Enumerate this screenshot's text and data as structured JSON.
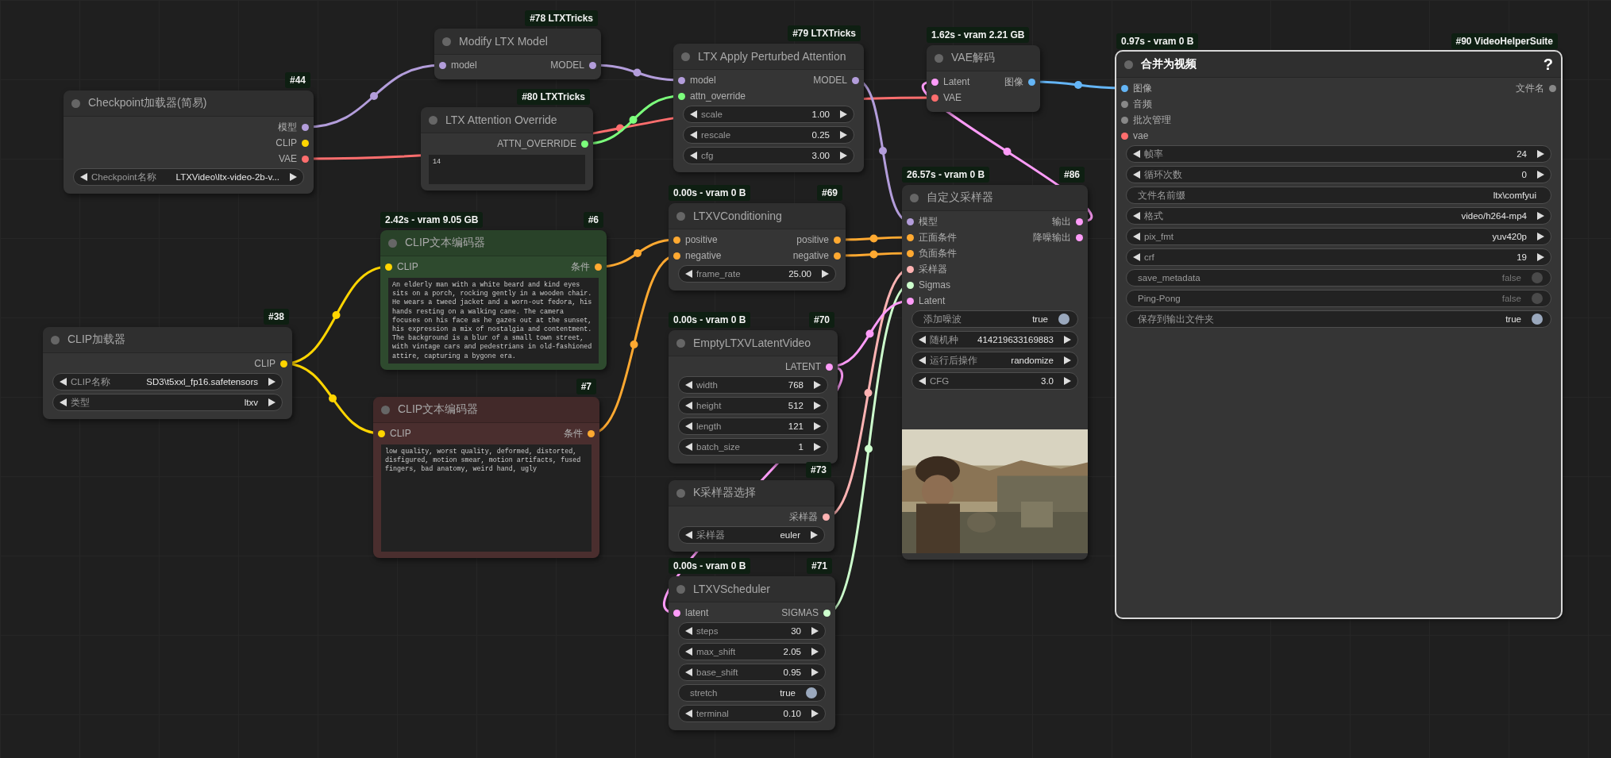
{
  "nodes": [
    {
      "badge": "#44",
      "title": "Checkpoint加载器(简易)",
      "selected": false,
      "outputs": [
        {
          "label": "模型",
          "color": "#b39ddb"
        },
        {
          "label": "CLIP",
          "color": "#ffd500"
        },
        {
          "label": "VAE",
          "color": "#ff6e6e"
        }
      ],
      "widgets": [
        {
          "kind": "stepper",
          "label": "Checkpoint名称",
          "value": "LTXVideo\\ltx-video-2b-v..."
        }
      ]
    },
    {
      "badge": "#78 LTXTricks",
      "title": "Modify LTX Model",
      "selected": false,
      "inputs": [
        {
          "label": "model",
          "color": "#b39ddb"
        }
      ],
      "outputs": [
        {
          "label": "MODEL",
          "color": "#b39ddb"
        }
      ]
    },
    {
      "badge": "#80 LTXTricks",
      "title": "LTX Attention Override",
      "selected": false,
      "outputs": [
        {
          "label": "ATTN_OVERRIDE",
          "color": "#7cff7c"
        }
      ],
      "widgets": [
        {
          "kind": "textarea",
          "value": "14"
        }
      ]
    },
    {
      "badge": "#79 LTXTricks",
      "title": "LTX Apply Perturbed Attention",
      "selected": false,
      "inputs": [
        {
          "label": "model",
          "color": "#b39ddb"
        },
        {
          "label": "attn_override",
          "color": "#7cff7c"
        }
      ],
      "outputs": [
        {
          "label": "MODEL",
          "color": "#b39ddb"
        }
      ],
      "widgets": [
        {
          "kind": "stepper",
          "label": "scale",
          "value": "1.00"
        },
        {
          "kind": "stepper",
          "label": "rescale",
          "value": "0.25"
        },
        {
          "kind": "stepper",
          "label": "cfg",
          "value": "3.00"
        }
      ]
    },
    {
      "timing": "1.62s - vram 2.21 GB",
      "title": "VAE解码",
      "selected": false,
      "inputs": [
        {
          "label": "Latent",
          "color": "#ff9cf9"
        },
        {
          "label": "VAE",
          "color": "#ff6e6e"
        }
      ],
      "outputs": [
        {
          "label": "图像",
          "color": "#64b5f6"
        }
      ]
    },
    {
      "timing": "0.97s - vram 0 B",
      "badge": "#90 VideoHelperSuite",
      "title": "合并为视频",
      "help": "?",
      "selected": true,
      "inputs": [
        {
          "label": "图像",
          "color": "#64b5f6"
        },
        {
          "label": "音频",
          "color": "#888888"
        },
        {
          "label": "批次管理",
          "color": "#888888"
        },
        {
          "label": "vae",
          "color": "#ff6e6e"
        }
      ],
      "outputs": [
        {
          "label": "文件名",
          "color": "#888888"
        }
      ],
      "widgets": [
        {
          "kind": "stepper",
          "label": "帧率",
          "value": "24"
        },
        {
          "kind": "stepper",
          "label": "循环次数",
          "value": "0"
        },
        {
          "kind": "text",
          "label": "文件名前缀",
          "value": "ltx\\comfyui"
        },
        {
          "kind": "stepper",
          "label": "格式",
          "value": "video/h264-mp4"
        },
        {
          "kind": "stepper",
          "label": "pix_fmt",
          "value": "yuv420p"
        },
        {
          "kind": "stepper",
          "label": "crf",
          "value": "19"
        },
        {
          "kind": "toggle",
          "label": "save_metadata",
          "value": "false",
          "on": false
        },
        {
          "kind": "toggle",
          "label": "Ping-Pong",
          "value": "false",
          "on": false
        },
        {
          "kind": "toggle",
          "label": "保存到输出文件夹",
          "value": "true",
          "on": true
        }
      ]
    },
    {
      "timing": "2.42s - vram 9.05 GB",
      "badge": "#6",
      "title": "CLIP文本编码器",
      "color": "#2e4a2e",
      "selected": false,
      "inputs": [
        {
          "label": "CLIP",
          "color": "#ffd500"
        }
      ],
      "outputs": [
        {
          "label": "条件",
          "color": "#ffa931"
        }
      ],
      "widgets": [
        {
          "kind": "textarea",
          "value": "An elderly man with a white beard and kind eyes sits on a porch, rocking gently in a wooden chair. He wears a tweed jacket and a worn-out fedora, his hands resting on a walking cane. The camera focuses on his face as he gazes out at the sunset, his expression a mix of nostalgia and contentment. The background is a blur of a small town street, with vintage cars and pedestrians in old-fashioned attire, capturing a bygone era."
        }
      ]
    },
    {
      "badge": "#7",
      "title": "CLIP文本编码器",
      "color": "#4a2e2e",
      "selected": false,
      "inputs": [
        {
          "label": "CLIP",
          "color": "#ffd500"
        }
      ],
      "outputs": [
        {
          "label": "条件",
          "color": "#ffa931"
        }
      ],
      "widgets": [
        {
          "kind": "textarea",
          "value": "low quality, worst quality, deformed, distorted, disfigured, motion smear, motion artifacts, fused fingers, bad anatomy, weird hand, ugly"
        }
      ]
    },
    {
      "badge": "#38",
      "title": "CLIP加载器",
      "selected": false,
      "outputs": [
        {
          "label": "CLIP",
          "color": "#ffd500"
        }
      ],
      "widgets": [
        {
          "kind": "stepper",
          "label": "CLIP名称",
          "value": "SD3\\t5xxl_fp16.safetensors"
        },
        {
          "kind": "stepper",
          "label": "类型",
          "value": "ltxv"
        }
      ]
    },
    {
      "timing": "0.00s - vram 0 B",
      "badge": "#69",
      "title": "LTXVConditioning",
      "selected": false,
      "inputs": [
        {
          "label": "positive",
          "color": "#ffa931"
        },
        {
          "label": "negative",
          "color": "#ffa931"
        }
      ],
      "outputs": [
        {
          "label": "positive",
          "color": "#ffa931"
        },
        {
          "label": "negative",
          "color": "#ffa931"
        }
      ],
      "widgets": [
        {
          "kind": "stepper",
          "label": "frame_rate",
          "value": "25.00"
        }
      ]
    },
    {
      "timing": "0.00s - vram 0 B",
      "badge": "#70",
      "title": "EmptyLTXVLatentVideo",
      "selected": false,
      "outputs": [
        {
          "label": "LATENT",
          "color": "#ff9cf9"
        }
      ],
      "widgets": [
        {
          "kind": "stepper",
          "label": "width",
          "value": "768"
        },
        {
          "kind": "stepper",
          "label": "height",
          "value": "512"
        },
        {
          "kind": "stepper",
          "label": "length",
          "value": "121"
        },
        {
          "kind": "stepper",
          "label": "batch_size",
          "value": "1"
        }
      ]
    },
    {
      "badge": "#73",
      "title": "K采样器选择",
      "selected": false,
      "outputs": [
        {
          "label": "采样器",
          "color": "#ffb3b3"
        }
      ],
      "widgets": [
        {
          "kind": "stepper",
          "label": "采样器",
          "value": "euler"
        }
      ]
    },
    {
      "timing": "0.00s - vram 0 B",
      "badge": "#71",
      "title": "LTXVScheduler",
      "selected": false,
      "inputs": [
        {
          "label": "latent",
          "color": "#ff9cf9"
        }
      ],
      "outputs": [
        {
          "label": "SIGMAS",
          "color": "#cdffcd"
        }
      ],
      "widgets": [
        {
          "kind": "stepper",
          "label": "steps",
          "value": "30"
        },
        {
          "kind": "stepper",
          "label": "max_shift",
          "value": "2.05"
        },
        {
          "kind": "stepper",
          "label": "base_shift",
          "value": "0.95"
        },
        {
          "kind": "toggle",
          "label": "stretch",
          "value": "true",
          "on": true
        },
        {
          "kind": "stepper",
          "label": "terminal",
          "value": "0.10"
        }
      ]
    },
    {
      "timing": "26.57s - vram 0 B",
      "badge": "#86",
      "title": "自定义采样器",
      "selected": false,
      "inputs": [
        {
          "label": "模型",
          "color": "#b39ddb"
        },
        {
          "label": "正面条件",
          "color": "#ffa931"
        },
        {
          "label": "负面条件",
          "color": "#ffa931"
        },
        {
          "label": "采样器",
          "color": "#ffb3b3"
        },
        {
          "label": "Sigmas",
          "color": "#cdffcd"
        },
        {
          "label": "Latent",
          "color": "#ff9cf9"
        }
      ],
      "outputs": [
        {
          "label": "输出",
          "color": "#ff9cf9"
        },
        {
          "label": "降噪输出",
          "color": "#ff9cf9"
        }
      ],
      "widgets": [
        {
          "kind": "toggle",
          "label": "添加噪波",
          "value": "true",
          "on": true
        },
        {
          "kind": "stepper",
          "label": "随机种",
          "value": "414219633169883"
        },
        {
          "kind": "stepper",
          "label": "运行后操作",
          "value": "randomize"
        },
        {
          "kind": "stepper",
          "label": "CFG",
          "value": "3.0"
        }
      ],
      "preview": {
        "kind": "picture"
      }
    }
  ]
}
